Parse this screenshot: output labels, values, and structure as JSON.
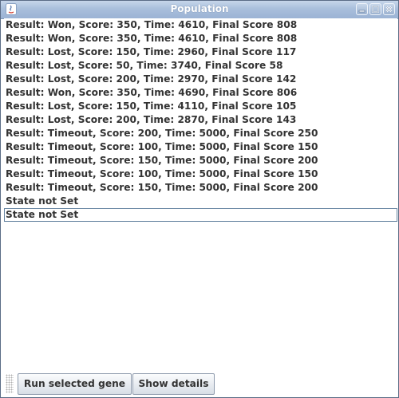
{
  "window": {
    "title": "Population"
  },
  "title_buttons": [
    {
      "icon": "minimize-icon"
    },
    {
      "icon": "maximize-icon"
    },
    {
      "icon": "close-icon"
    }
  ],
  "results": [
    "Result: Won, Score: 350, Time: 4610, Final Score 808",
    "Result: Won, Score: 350, Time: 4610, Final Score 808",
    "Result: Lost, Score: 150, Time: 2960, Final Score 117",
    "Result: Lost, Score: 50, Time: 3740, Final Score 58",
    "Result: Lost, Score: 200, Time: 2970, Final Score 142",
    "Result: Won, Score: 350, Time: 4690, Final Score 806",
    "Result: Lost, Score: 150, Time: 4110, Final Score 105",
    "Result: Lost, Score: 200, Time: 2870, Final Score 143",
    "Result: Timeout, Score: 200, Time: 5000, Final Score 250",
    "Result: Timeout, Score: 100, Time: 5000, Final Score 150",
    "Result: Timeout, Score: 150, Time: 5000, Final Score 200",
    "Result: Timeout, Score: 100, Time: 5000, Final Score 150",
    "Result: Timeout, Score: 150, Time: 5000, Final Score 200",
    "State not Set",
    "State not Set"
  ],
  "selected_index": 14,
  "buttons": {
    "run_label": "Run selected gene",
    "details_label": "Show details"
  },
  "colors": {
    "titlebar": "#a9bfdc",
    "selection_border": "#63829f",
    "text": "#333333"
  }
}
